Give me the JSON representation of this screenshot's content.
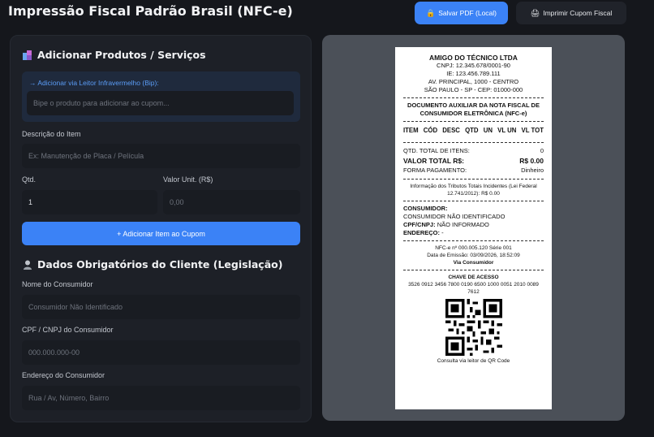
{
  "header": {
    "title": "Impressão Fiscal Padrão Brasil (NFC-e)",
    "pdf_button": "Salvar PDF (Local)",
    "print_button": "Imprimir Cupom Fiscal"
  },
  "products": {
    "section_title": "Adicionar Produtos / Serviços",
    "scanner_label": "→ Adicionar via Leitor Infravermelho (Bip):",
    "scanner_placeholder": "Bipe o produto para adicionar ao cupom...",
    "description_label": "Descrição do Item",
    "description_placeholder": "Ex: Manutenção de Placa / Película",
    "qty_label": "Qtd.",
    "qty_value": "1",
    "unit_label": "Valor Unit. (R$)",
    "unit_placeholder": "0,00",
    "add_button": "+ Adicionar Item ao Cupom"
  },
  "customer": {
    "section_title": "Dados Obrigatórios do Cliente (Legislação)",
    "name_label": "Nome do Consumidor",
    "name_placeholder": "Consumidor Não Identificado",
    "doc_label": "CPF / CNPJ do Consumidor",
    "doc_placeholder": "000.000.000-00",
    "address_label": "Endereço do Consumidor",
    "address_placeholder": "Rua / Av, Número, Bairro"
  },
  "receipt": {
    "company": "AMIGO DO TÉCNICO LTDA",
    "cnpj": "CNPJ: 12.345.678/0001-90",
    "ie": "IE: 123.456.789.111",
    "address": "AV. PRINCIPAL, 1000 - CENTRO",
    "city": "SÃO PAULO - SP - CEP: 01000-000",
    "doc_title": "DOCUMENTO AUXILIAR DA NOTA FISCAL DE CONSUMIDOR ELETRÔNICA (NFC-e)",
    "table_header": [
      "ITEM",
      "CÓD",
      "DESC",
      "QTD",
      "UN",
      "VL UN",
      "VL TOT"
    ],
    "total_items_label": "QTD. TOTAL DE ITENS:",
    "total_items_value": "0",
    "total_value_label": "VALOR TOTAL R$:",
    "total_value": "R$ 0.00",
    "payment_label": "FORMA PAGAMENTO:",
    "payment_value": "Dinheiro",
    "taxes_note": "Informação dos Tributos Totais Incidentes (Lei Federal 12.741/2012): R$ 0.00",
    "consumer_heading": "CONSUMIDOR:",
    "consumer_name": "CONSUMIDOR NÃO IDENTIFICADO",
    "consumer_doc_label": "CPF/CNPJ:",
    "consumer_doc_value": "NÃO INFORMADO",
    "consumer_address_label": "ENDEREÇO:",
    "consumer_address_value": "-",
    "nfce_number": "NFC-e nº 000.005.120 Série 001",
    "emission_date": "Data de Emissão: 03/09/2026, 18:52:09",
    "via": "Via Consumidor",
    "access_key_label": "CHAVE DE ACESSO",
    "access_key": "3526 0912 3456 7800 0190 6500 1000 0051 2010 0089 7612",
    "qr_caption": "Consulta via leitor de QR Code"
  },
  "colors": {
    "accent": "#3b82f6",
    "background": "#15171c",
    "card": "#1d2027",
    "preview_panel": "#4b5058"
  }
}
